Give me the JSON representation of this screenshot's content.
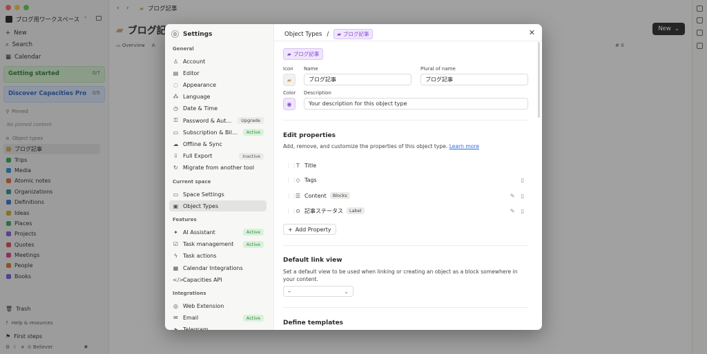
{
  "workspace": {
    "name": "ブログ用ワークスペース"
  },
  "sidebar": {
    "new": "New",
    "search": "Search",
    "calendar": "Calendar",
    "getting_started": {
      "label": "Getting started",
      "count": "0/7"
    },
    "discover": {
      "label": "Discover Capacities Pro",
      "count": "0/5"
    },
    "pinned_header": "Pinned",
    "no_pinned": "No pinned content",
    "object_types_header": "Object types",
    "object_types": [
      {
        "label": "ブログ記事",
        "color": "#c9a46a"
      },
      {
        "label": "Trips",
        "color": "#3e9e57"
      },
      {
        "label": "Media",
        "color": "#2e8bcb"
      },
      {
        "label": "Atomic notes",
        "color": "#d66a3a"
      },
      {
        "label": "Organizations",
        "color": "#2a8d8d"
      },
      {
        "label": "Definitions",
        "color": "#3a6fd0"
      },
      {
        "label": "Ideas",
        "color": "#c7a52a"
      },
      {
        "label": "Places",
        "color": "#3fa35b"
      },
      {
        "label": "Projects",
        "color": "#7f5ad3"
      },
      {
        "label": "Quotes",
        "color": "#d14d4d"
      },
      {
        "label": "Meetings",
        "color": "#d63b85"
      },
      {
        "label": "People",
        "color": "#d9702f"
      },
      {
        "label": "Books",
        "color": "#6b5bd3"
      }
    ],
    "trash": "Trash",
    "help": "Help & resources",
    "first_steps": "First steps",
    "believer": "Believer"
  },
  "topbar": {
    "title": "ブログ記事"
  },
  "main": {
    "title": "ブログ記",
    "tab_overview": "Overview",
    "tab_all": "A",
    "new_button": "New",
    "hash_count": "0"
  },
  "settings": {
    "title": "Settings",
    "sections": [
      {
        "header": "General",
        "items": [
          {
            "label": "Account",
            "icon": "user-icon"
          },
          {
            "label": "Editor",
            "icon": "editor-icon"
          },
          {
            "label": "Appearance",
            "icon": "palette-icon"
          },
          {
            "label": "Language",
            "icon": "language-icon"
          },
          {
            "label": "Date & Time",
            "icon": "clock-icon"
          },
          {
            "label": "Password & Authentication",
            "icon": "key-icon",
            "badge": "Upgrade",
            "badge_type": "upgrade"
          },
          {
            "label": "Subscription & Billing",
            "icon": "card-icon",
            "badge": "Active",
            "badge_type": "active"
          },
          {
            "label": "Offline & Sync",
            "icon": "cloud-icon"
          },
          {
            "label": "Full Export",
            "icon": "export-icon",
            "badge": "Inactive",
            "badge_type": "inactive"
          },
          {
            "label": "Migrate from another tool",
            "icon": "migrate-icon"
          }
        ]
      },
      {
        "header": "Current space",
        "items": [
          {
            "label": "Space Settings",
            "icon": "monitor-icon"
          },
          {
            "label": "Object Types",
            "icon": "folder-icon",
            "selected": true
          }
        ]
      },
      {
        "header": "Features",
        "items": [
          {
            "label": "AI Assistant",
            "icon": "sparkle-icon",
            "badge": "Active",
            "badge_type": "active"
          },
          {
            "label": "Task management",
            "icon": "check-icon",
            "badge": "Active",
            "badge_type": "active"
          },
          {
            "label": "Task actions",
            "icon": "bolt-icon"
          },
          {
            "label": "Calendar Integrations",
            "icon": "calendar-icon"
          },
          {
            "label": "Capacities API",
            "icon": "code-icon"
          }
        ]
      },
      {
        "header": "Integrations",
        "items": [
          {
            "label": "Web Extension",
            "icon": "globe-icon"
          },
          {
            "label": "Email",
            "icon": "mail-icon",
            "badge": "Active",
            "badge_type": "active"
          },
          {
            "label": "Telegram",
            "icon": "telegram-icon"
          }
        ]
      }
    ]
  },
  "object_type": {
    "breadcrumb_root": "Object Types",
    "breadcrumb_sep": "/",
    "name_chip": "ブログ記事",
    "icon_label": "Icon",
    "name_label": "Name",
    "plural_label": "Plural of name",
    "name_value": "ブログ記事",
    "plural_value": "ブログ記事",
    "color_label": "Color",
    "description_label": "Description",
    "description_placeholder": "Your description for this object type",
    "edit_props_title": "Edit properties",
    "edit_props_desc": "Add, remove, and customize the properties of this object type.",
    "learn_more": "Learn more",
    "properties": [
      {
        "label": "Title",
        "icon": "T",
        "tag": "",
        "actions": false
      },
      {
        "label": "Tags",
        "icon": "◇",
        "tag": "",
        "actions": "delete"
      },
      {
        "label": "Content",
        "icon": "☰",
        "tag": "Blocks",
        "actions": "both"
      },
      {
        "label": "記事ステータス",
        "icon": "⊙",
        "tag": "Label",
        "actions": "both"
      }
    ],
    "add_property": "Add Property",
    "default_link_title": "Default link view",
    "default_link_desc": "Set a default view to be used when linking or creating an object as a block somewhere in your content.",
    "default_link_value": "–",
    "define_templates_title": "Define templates"
  },
  "colors": {
    "accent_purple": "#8a4bd3",
    "active_green": "#2f8d36",
    "link_blue": "#2f6bd6"
  }
}
